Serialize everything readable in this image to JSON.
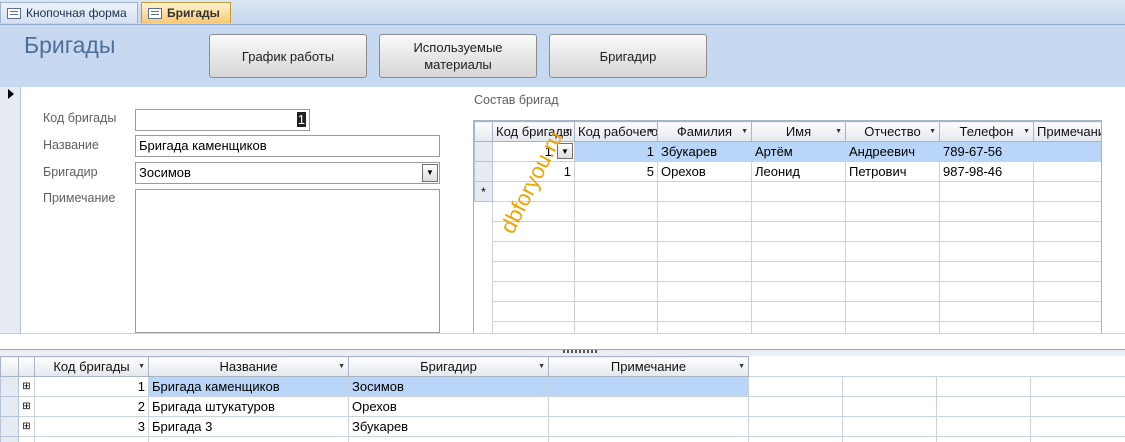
{
  "tabs": [
    {
      "label": "Кнопочная форма",
      "active": false
    },
    {
      "label": "Бригады",
      "active": true
    }
  ],
  "form": {
    "title": "Бригады",
    "buttons": {
      "schedule": "График работы",
      "materials": "Используемые материалы",
      "foreman": "Бригадир"
    },
    "labels": {
      "code": "Код бригады",
      "name": "Название",
      "foreman": "Бригадир",
      "note": "Примечание"
    },
    "values": {
      "code": "1",
      "name": "Бригада каменщиков",
      "foreman": "Зосимов",
      "note": ""
    }
  },
  "subform": {
    "title": "Состав бригад",
    "columns": [
      "Код бригады",
      "Код рабочего",
      "Фамилия",
      "Имя",
      "Отчество",
      "Телефон",
      "Примечание"
    ],
    "rows": [
      {
        "brigade": "1",
        "worker": "1",
        "surname": "Збукарев",
        "name": "Артём",
        "patronymic": "Андреевич",
        "phone": "789-67-56",
        "note": ""
      },
      {
        "brigade": "1",
        "worker": "5",
        "surname": "Орехов",
        "name": "Леонид",
        "patronymic": "Петрович",
        "phone": "987-98-46",
        "note": ""
      }
    ],
    "new_row_marker": "*"
  },
  "datasheet": {
    "columns": [
      "Код бригады",
      "Название",
      "Бригадир",
      "Примечание"
    ],
    "rows": [
      {
        "code": "1",
        "name": "Бригада каменщиков",
        "foreman": "Зосимов",
        "note": ""
      },
      {
        "code": "2",
        "name": "Бригада штукатуров",
        "foreman": "Орехов",
        "note": ""
      },
      {
        "code": "3",
        "name": "Бригада 3",
        "foreman": "Збукарев",
        "note": ""
      }
    ]
  },
  "watermark": "dbforyou.ru"
}
